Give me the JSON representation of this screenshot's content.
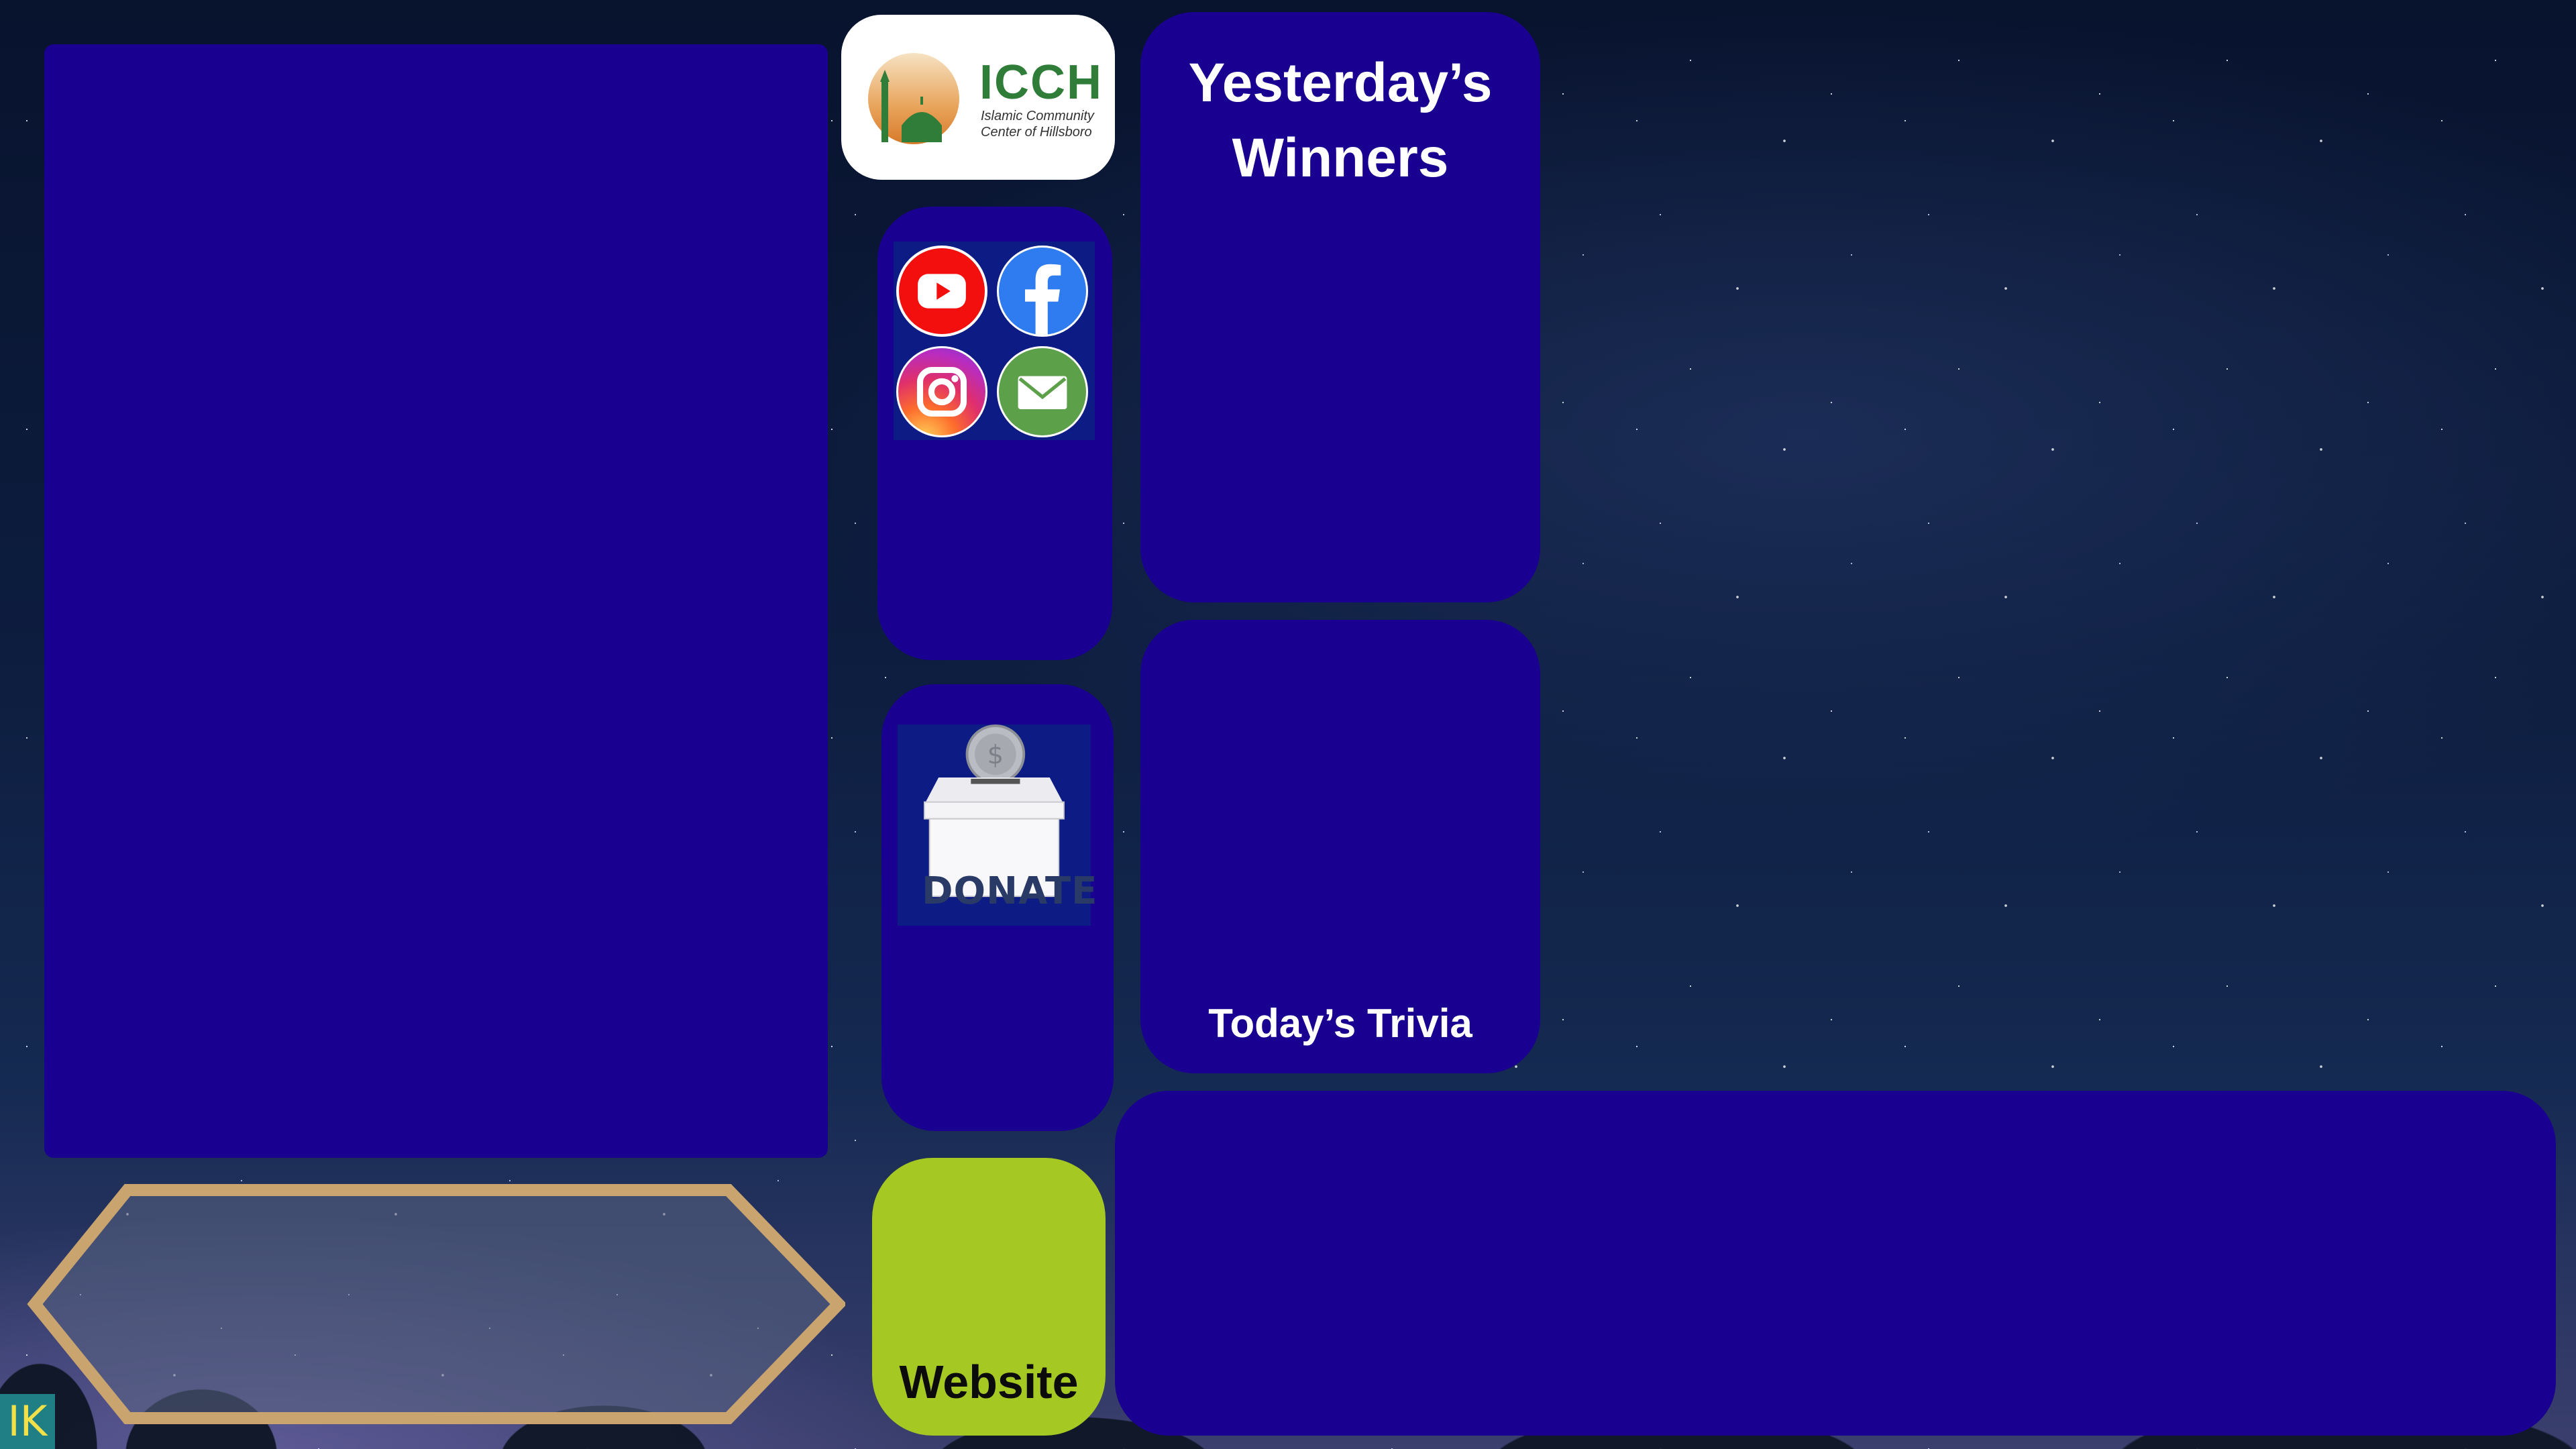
{
  "logo": {
    "name": "ICCH",
    "subtitle_line1": "Islamic Community",
    "subtitle_line2": "Center of Hillsboro"
  },
  "social": {
    "items": [
      "youtube",
      "facebook",
      "instagram",
      "email"
    ]
  },
  "donate": {
    "label": "DONATE"
  },
  "winners": {
    "title": "Yesterday’s Winners"
  },
  "trivia": {
    "label": "Today’s Trivia"
  },
  "website": {
    "label": "Website"
  },
  "badge": {
    "label": "IK"
  },
  "colors": {
    "panel": "#1a0090",
    "website_button": "#a5c823",
    "hex_frame": "#c9a46e",
    "logo_green": "#2f7d38"
  }
}
